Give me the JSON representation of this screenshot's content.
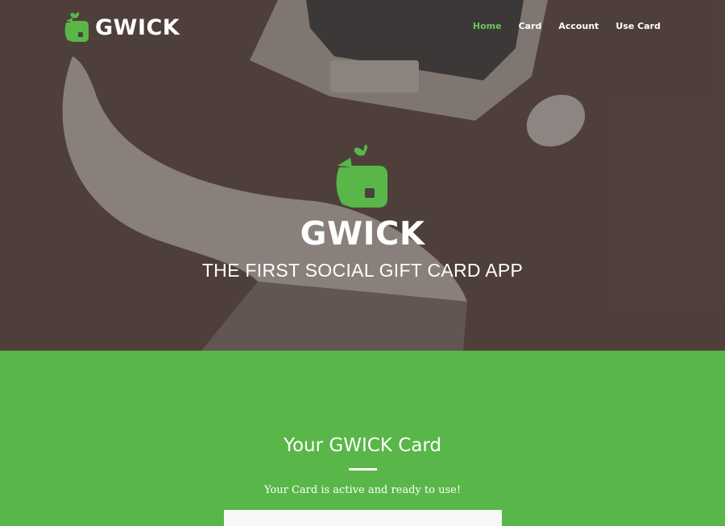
{
  "brand": {
    "name": "GWICK",
    "icon": "gift-card-logo-icon"
  },
  "nav": {
    "items": [
      {
        "label": "Home",
        "active": true
      },
      {
        "label": "Card",
        "active": false
      },
      {
        "label": "Account",
        "active": false
      },
      {
        "label": "Use Card",
        "active": false
      }
    ]
  },
  "hero": {
    "logo_word": "GWICK",
    "tagline": "THE FIRST SOCIAL GIFT CARD APP"
  },
  "card_section": {
    "title": "Your GWICK Card",
    "status": "Your Card is active and ready to use!"
  },
  "colors": {
    "accent_green": "#58b748",
    "nav_active": "#6cc55a",
    "hero_overlay": "#4d3f3b"
  }
}
